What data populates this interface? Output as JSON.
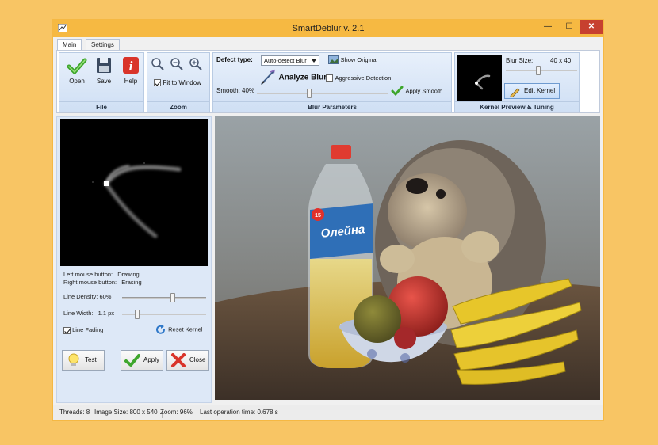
{
  "window": {
    "title": "SmartDeblur v. 2.1",
    "close_glyph": "✕",
    "min_glyph": "—",
    "max_glyph": "☐"
  },
  "tabs": [
    {
      "label": "Main"
    },
    {
      "label": "Settings"
    }
  ],
  "ribbon": {
    "file": {
      "label": "File",
      "open": "Open",
      "save": "Save",
      "help": "Help"
    },
    "zoom": {
      "label": "Zoom",
      "fit_to_window": "Fit to Window",
      "fit_checked": true
    },
    "blur": {
      "label": "Blur Parameters",
      "defect_type_label": "Defect type:",
      "defect_type_value": "Auto-detect Blur",
      "show_original": "Show Original",
      "analyze_blur": "Analyze Blur",
      "aggressive_detection": "Aggressive Detection",
      "smooth_label": "Smooth:",
      "smooth_value": "40%",
      "smooth_level": 0.4,
      "apply_smooth": "Apply Smooth"
    },
    "kernel": {
      "label": "Kernel Preview & Tuning",
      "blur_size_label": "Blur Size:",
      "blur_size_value": "40 x 40",
      "blur_size_level": 0.45,
      "edit_kernel": "Edit Kernel"
    }
  },
  "left_panel": {
    "hint_left": "Left mouse button:",
    "hint_left_value": "Drawing",
    "hint_right": "Right mouse button:",
    "hint_right_value": "Erasing",
    "line_density_label": "Line Density:",
    "line_density_value": "60%",
    "line_density_level": 0.6,
    "line_width_label": "Line Width:",
    "line_width_value": "1.1 px",
    "line_width_level": 0.18,
    "line_fading": "Line Fading",
    "line_fading_checked": true,
    "reset_kernel": "Reset Kernel",
    "test": "Test",
    "apply": "Apply",
    "close": "Close"
  },
  "status": {
    "threads": "Threads: 8",
    "image_size": "Image Size: 800 x 540",
    "zoom": "Zoom: 96%",
    "last_op": "Last operation time: 0.678 s"
  },
  "photo": {
    "bottle_label_brand": "Олейна",
    "bottle_label_badge": "15"
  },
  "colors": {
    "background": "#f8c564",
    "titlebar": "#f6b942",
    "close": "#c7402f",
    "accent_blue": "#1e6fd0"
  }
}
